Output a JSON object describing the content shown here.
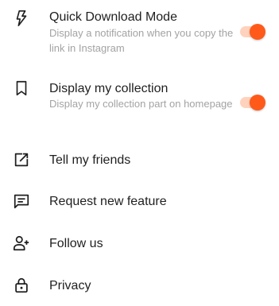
{
  "settings": {
    "quick_download": {
      "title": "Quick Download Mode",
      "description": "Display a notification when you copy the link in Instagram",
      "enabled": true,
      "icon": "flash-icon"
    },
    "display_collection": {
      "title": "Display my collection",
      "description": "Display my collection part on homepage",
      "enabled": true,
      "icon": "bookmark-icon"
    },
    "tell_friends": {
      "title": "Tell my friends",
      "icon": "share-icon"
    },
    "request_feature": {
      "title": "Request new feature",
      "icon": "message-icon"
    },
    "follow_us": {
      "title": "Follow us",
      "icon": "person-add-icon"
    },
    "privacy": {
      "title": "Privacy",
      "icon": "lock-icon"
    }
  },
  "colors": {
    "accent": "#ff5a1a",
    "accent_track": "#ffd2bd",
    "secondary_text": "#a3a3a3",
    "primary_text": "#1f1f1f"
  }
}
